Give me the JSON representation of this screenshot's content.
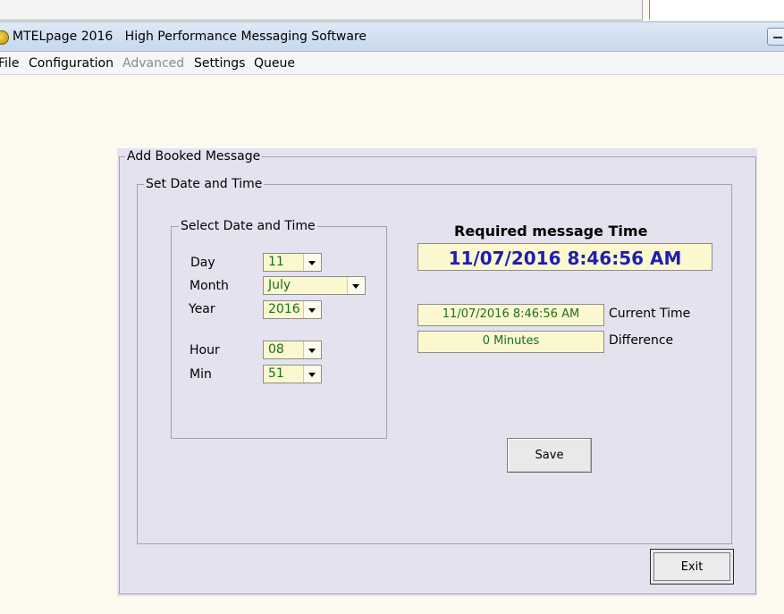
{
  "window": {
    "title": "MTELpage 2016   High Performance Messaging Software"
  },
  "menu": [
    {
      "label": "File",
      "enabled": true
    },
    {
      "label": "Configuration",
      "enabled": true
    },
    {
      "label": "Advanced",
      "enabled": false
    },
    {
      "label": "Settings",
      "enabled": true
    },
    {
      "label": "Queue",
      "enabled": true
    }
  ],
  "form": {
    "group_title": "Add Booked Message",
    "set_title": "Set Date and Time",
    "select_title": "Select Date and Time",
    "fields": {
      "day": {
        "label": "Day",
        "value": "11"
      },
      "month": {
        "label": "Month",
        "value": "July"
      },
      "year": {
        "label": "Year",
        "value": "2016"
      },
      "hour": {
        "label": "Hour",
        "value": "08"
      },
      "min": {
        "label": "Min",
        "value": "51"
      }
    },
    "required_label": "Required message Time",
    "required_value": "11/07/2016 8:46:56 AM",
    "current_time_value": "11/07/2016 8:46:56 AM",
    "current_time_label": "Current Time",
    "difference_value": "0 Minutes",
    "difference_label": "Difference",
    "save_label": "Save",
    "exit_label": "Exit"
  },
  "colors": {
    "background": "#fdf9ee",
    "panel": "#e4e2ee",
    "field_bg": "#fbf8cf",
    "field_text": "#1c6e1c",
    "required_text": "#1e1eb4"
  }
}
